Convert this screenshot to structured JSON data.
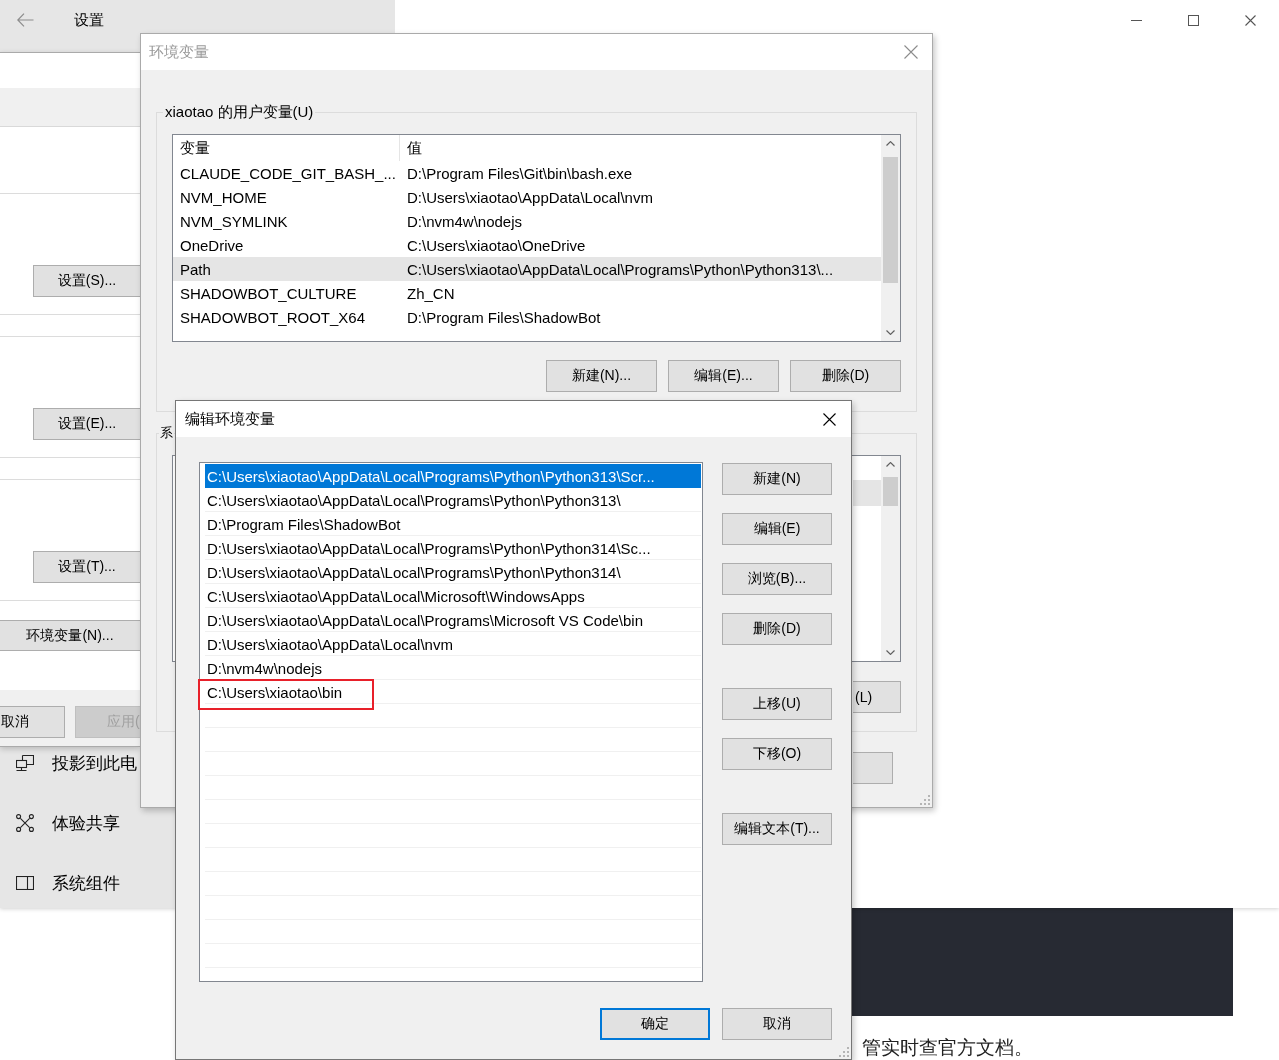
{
  "settings_window": {
    "title": "设置",
    "nav_items": [
      {
        "label": "投影到此电",
        "selected": false
      },
      {
        "label": "体验共享",
        "selected": false
      },
      {
        "label": "系统组件",
        "selected": false
      }
    ]
  },
  "system_properties": {
    "group_buttons": [
      {
        "label": "设置(S)..."
      },
      {
        "label": "设置(E)..."
      },
      {
        "label": "设置(T)..."
      }
    ],
    "env_button": {
      "label": "环境变量(N)..."
    },
    "footer_buttons": [
      {
        "label": "取消",
        "disabled": false
      },
      {
        "label": "应用(",
        "disabled": true
      }
    ]
  },
  "environment_variables_dialog": {
    "title": "环境变量",
    "active": false,
    "user_variables": {
      "label": "xiaotao 的用户变量(U)",
      "columns": [
        "变量",
        "值"
      ],
      "rows": [
        {
          "name": "CLAUDE_CODE_GIT_BASH_...",
          "value": "D:\\Program Files\\Git\\bin\\bash.exe",
          "selected": false
        },
        {
          "name": "NVM_HOME",
          "value": "D:\\Users\\xiaotao\\AppData\\Local\\nvm",
          "selected": false
        },
        {
          "name": "NVM_SYMLINK",
          "value": "D:\\nvm4w\\nodejs",
          "selected": false
        },
        {
          "name": "OneDrive",
          "value": "C:\\Users\\xiaotao\\OneDrive",
          "selected": false
        },
        {
          "name": "Path",
          "value": "C:\\Users\\xiaotao\\AppData\\Local\\Programs\\Python\\Python313\\...",
          "selected": true
        },
        {
          "name": "SHADOWBOT_CULTURE",
          "value": "Zh_CN",
          "selected": false
        },
        {
          "name": "SHADOWBOT_ROOT_X64",
          "value": "D:\\Program Files\\ShadowBot",
          "selected": false
        }
      ],
      "buttons": [
        "新建(N)...",
        "编辑(E)...",
        "删除(D)"
      ]
    },
    "system_variables": {
      "label": "系",
      "rows": [
        {
          "selected": true
        }
      ],
      "buttons": [
        "(L)"
      ]
    }
  },
  "edit_dialog": {
    "title": "编辑环境变量",
    "active": true,
    "entries": [
      {
        "text": "C:\\Users\\xiaotao\\AppData\\Local\\Programs\\Python\\Python313\\Scr...",
        "selected": true,
        "highlighted": false
      },
      {
        "text": "C:\\Users\\xiaotao\\AppData\\Local\\Programs\\Python\\Python313\\",
        "selected": false,
        "highlighted": false
      },
      {
        "text": "D:\\Program Files\\ShadowBot",
        "selected": false,
        "highlighted": false
      },
      {
        "text": "D:\\Users\\xiaotao\\AppData\\Local\\Programs\\Python\\Python314\\Sc...",
        "selected": false,
        "highlighted": false
      },
      {
        "text": "D:\\Users\\xiaotao\\AppData\\Local\\Programs\\Python\\Python314\\",
        "selected": false,
        "highlighted": false
      },
      {
        "text": "C:\\Users\\xiaotao\\AppData\\Local\\Microsoft\\WindowsApps",
        "selected": false,
        "highlighted": false
      },
      {
        "text": "D:\\Users\\xiaotao\\AppData\\Local\\Programs\\Microsoft VS Code\\bin",
        "selected": false,
        "highlighted": false
      },
      {
        "text": "D:\\Users\\xiaotao\\AppData\\Local\\nvm",
        "selected": false,
        "highlighted": false
      },
      {
        "text": "D:\\nvm4w\\nodejs",
        "selected": false,
        "highlighted": false
      },
      {
        "text": "C:\\Users\\xiaotao\\bin",
        "selected": false,
        "highlighted": true
      }
    ],
    "side_button_groups": [
      {
        "buttons": [
          "新建(N)",
          "编辑(E)",
          "浏览(B)...",
          "删除(D)"
        ]
      },
      {
        "buttons": [
          "上移(U)",
          "下移(O)"
        ]
      },
      {
        "buttons": [
          "编辑文本(T)..."
        ]
      }
    ],
    "footer_buttons": [
      {
        "label": "确定",
        "default": true
      },
      {
        "label": "取消",
        "default": false
      }
    ]
  },
  "background_page": {
    "text": "管实时查官方文档。"
  }
}
